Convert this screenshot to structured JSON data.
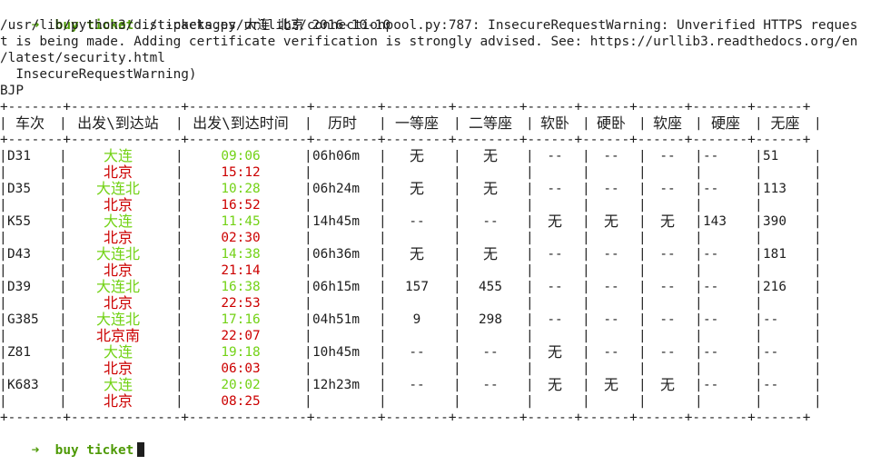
{
  "terminal": {
    "prompt_arrow": "➜",
    "prompt_text": "buy ticket",
    "command": "./tickets.py 大连 北京 2016-10-10",
    "warning_lines": [
      "/usr/lib/python3/dist-packages/urllib3/connectionpool.py:787: InsecureRequestWarning: Unverified HTTPS reques",
      "t is being made. Adding certificate verification is strongly advised. See: https://urllib3.readthedocs.org/en",
      "/latest/security.html",
      "  InsecureRequestWarning)"
    ],
    "station_code": "BJP",
    "final_prompt": "buy ticket"
  },
  "table": {
    "headers": [
      "车次",
      "出发\\到达站",
      "出发\\到达时间",
      "历时",
      "一等座",
      "二等座",
      "软卧",
      "硬卧",
      "软座",
      "硬座",
      "无座"
    ],
    "rows": [
      {
        "train": "D31",
        "from": "大连",
        "to": "北京",
        "dep": "09:06",
        "arr": "15:12",
        "dur": "06h06m",
        "first": "无",
        "second": "无",
        "soft_sleep": "--",
        "hard_sleep": "--",
        "soft_seat": "--",
        "hard_seat": "--",
        "no_seat": "51"
      },
      {
        "train": "D35",
        "from": "大连北",
        "to": "北京",
        "dep": "10:28",
        "arr": "16:52",
        "dur": "06h24m",
        "first": "无",
        "second": "无",
        "soft_sleep": "--",
        "hard_sleep": "--",
        "soft_seat": "--",
        "hard_seat": "--",
        "no_seat": "113"
      },
      {
        "train": "K55",
        "from": "大连",
        "to": "北京",
        "dep": "11:45",
        "arr": "02:30",
        "dur": "14h45m",
        "first": "--",
        "second": "--",
        "soft_sleep": "无",
        "hard_sleep": "无",
        "soft_seat": "无",
        "hard_seat": "143",
        "no_seat": "390"
      },
      {
        "train": "D43",
        "from": "大连北",
        "to": "北京",
        "dep": "14:38",
        "arr": "21:14",
        "dur": "06h36m",
        "first": "无",
        "second": "无",
        "soft_sleep": "--",
        "hard_sleep": "--",
        "soft_seat": "--",
        "hard_seat": "--",
        "no_seat": "181"
      },
      {
        "train": "D39",
        "from": "大连北",
        "to": "北京",
        "dep": "16:38",
        "arr": "22:53",
        "dur": "06h15m",
        "first": "157",
        "second": "455",
        "soft_sleep": "--",
        "hard_sleep": "--",
        "soft_seat": "--",
        "hard_seat": "--",
        "no_seat": "216"
      },
      {
        "train": "G385",
        "from": "大连北",
        "to": "北京南",
        "dep": "17:16",
        "arr": "22:07",
        "dur": "04h51m",
        "first": "9",
        "second": "298",
        "soft_sleep": "--",
        "hard_sleep": "--",
        "soft_seat": "--",
        "hard_seat": "--",
        "no_seat": "--"
      },
      {
        "train": "Z81",
        "from": "大连",
        "to": "北京",
        "dep": "19:18",
        "arr": "06:03",
        "dur": "10h45m",
        "first": "--",
        "second": "--",
        "soft_sleep": "无",
        "hard_sleep": "--",
        "soft_seat": "--",
        "hard_seat": "--",
        "no_seat": "--"
      },
      {
        "train": "K683",
        "from": "大连",
        "to": "北京",
        "dep": "20:02",
        "arr": "08:25",
        "dur": "12h23m",
        "first": "--",
        "second": "--",
        "soft_sleep": "无",
        "hard_sleep": "无",
        "soft_seat": "无",
        "hard_seat": "--",
        "no_seat": "--"
      }
    ]
  },
  "colors": {
    "prompt_green": "#4e9a06",
    "station_from": "#73d216",
    "station_to": "#cc0000",
    "text": "#1e1e1e",
    "background": "#ffffff"
  }
}
